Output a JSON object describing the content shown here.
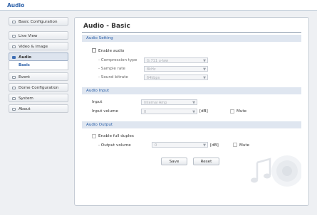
{
  "window": {
    "title": "Audio"
  },
  "sidebar": {
    "items": [
      {
        "label": "Basic Configuration"
      },
      {
        "label": "Live View"
      },
      {
        "label": "Video & Image"
      },
      {
        "label": "Audio"
      },
      {
        "label": "Basic"
      },
      {
        "label": "Event"
      },
      {
        "label": "Dome Configuration"
      },
      {
        "label": "System"
      },
      {
        "label": "About"
      }
    ]
  },
  "main": {
    "title": "Audio - Basic",
    "audio_setting": {
      "header": "Audio Setting",
      "enable_audio_label": "Enable audio",
      "compression_label": "- Compression type",
      "compression_value": "G.711 u-law",
      "sample_rate_label": "- Sample rate",
      "sample_rate_value": "8kHz",
      "bitrate_label": "- Sound bitrate",
      "bitrate_value": "64kbps"
    },
    "audio_input": {
      "header": "Audio Input",
      "input_label": "Input",
      "input_value": "Internal Amp",
      "volume_label": "Input volume",
      "volume_value": "0",
      "unit": "[dB]",
      "mute_label": "Mute"
    },
    "audio_output": {
      "header": "Audio Output",
      "duplex_label": "Enable full duplex",
      "volume_label": "- Output volume",
      "volume_value": "0",
      "unit": "[dB]",
      "mute_label": "Mute"
    },
    "buttons": {
      "save": "Save",
      "reset": "Reset"
    }
  },
  "colors": {
    "accent": "#2a5fa8",
    "section_bg": "#dfe6f0",
    "page_bg": "#eef0f3"
  }
}
